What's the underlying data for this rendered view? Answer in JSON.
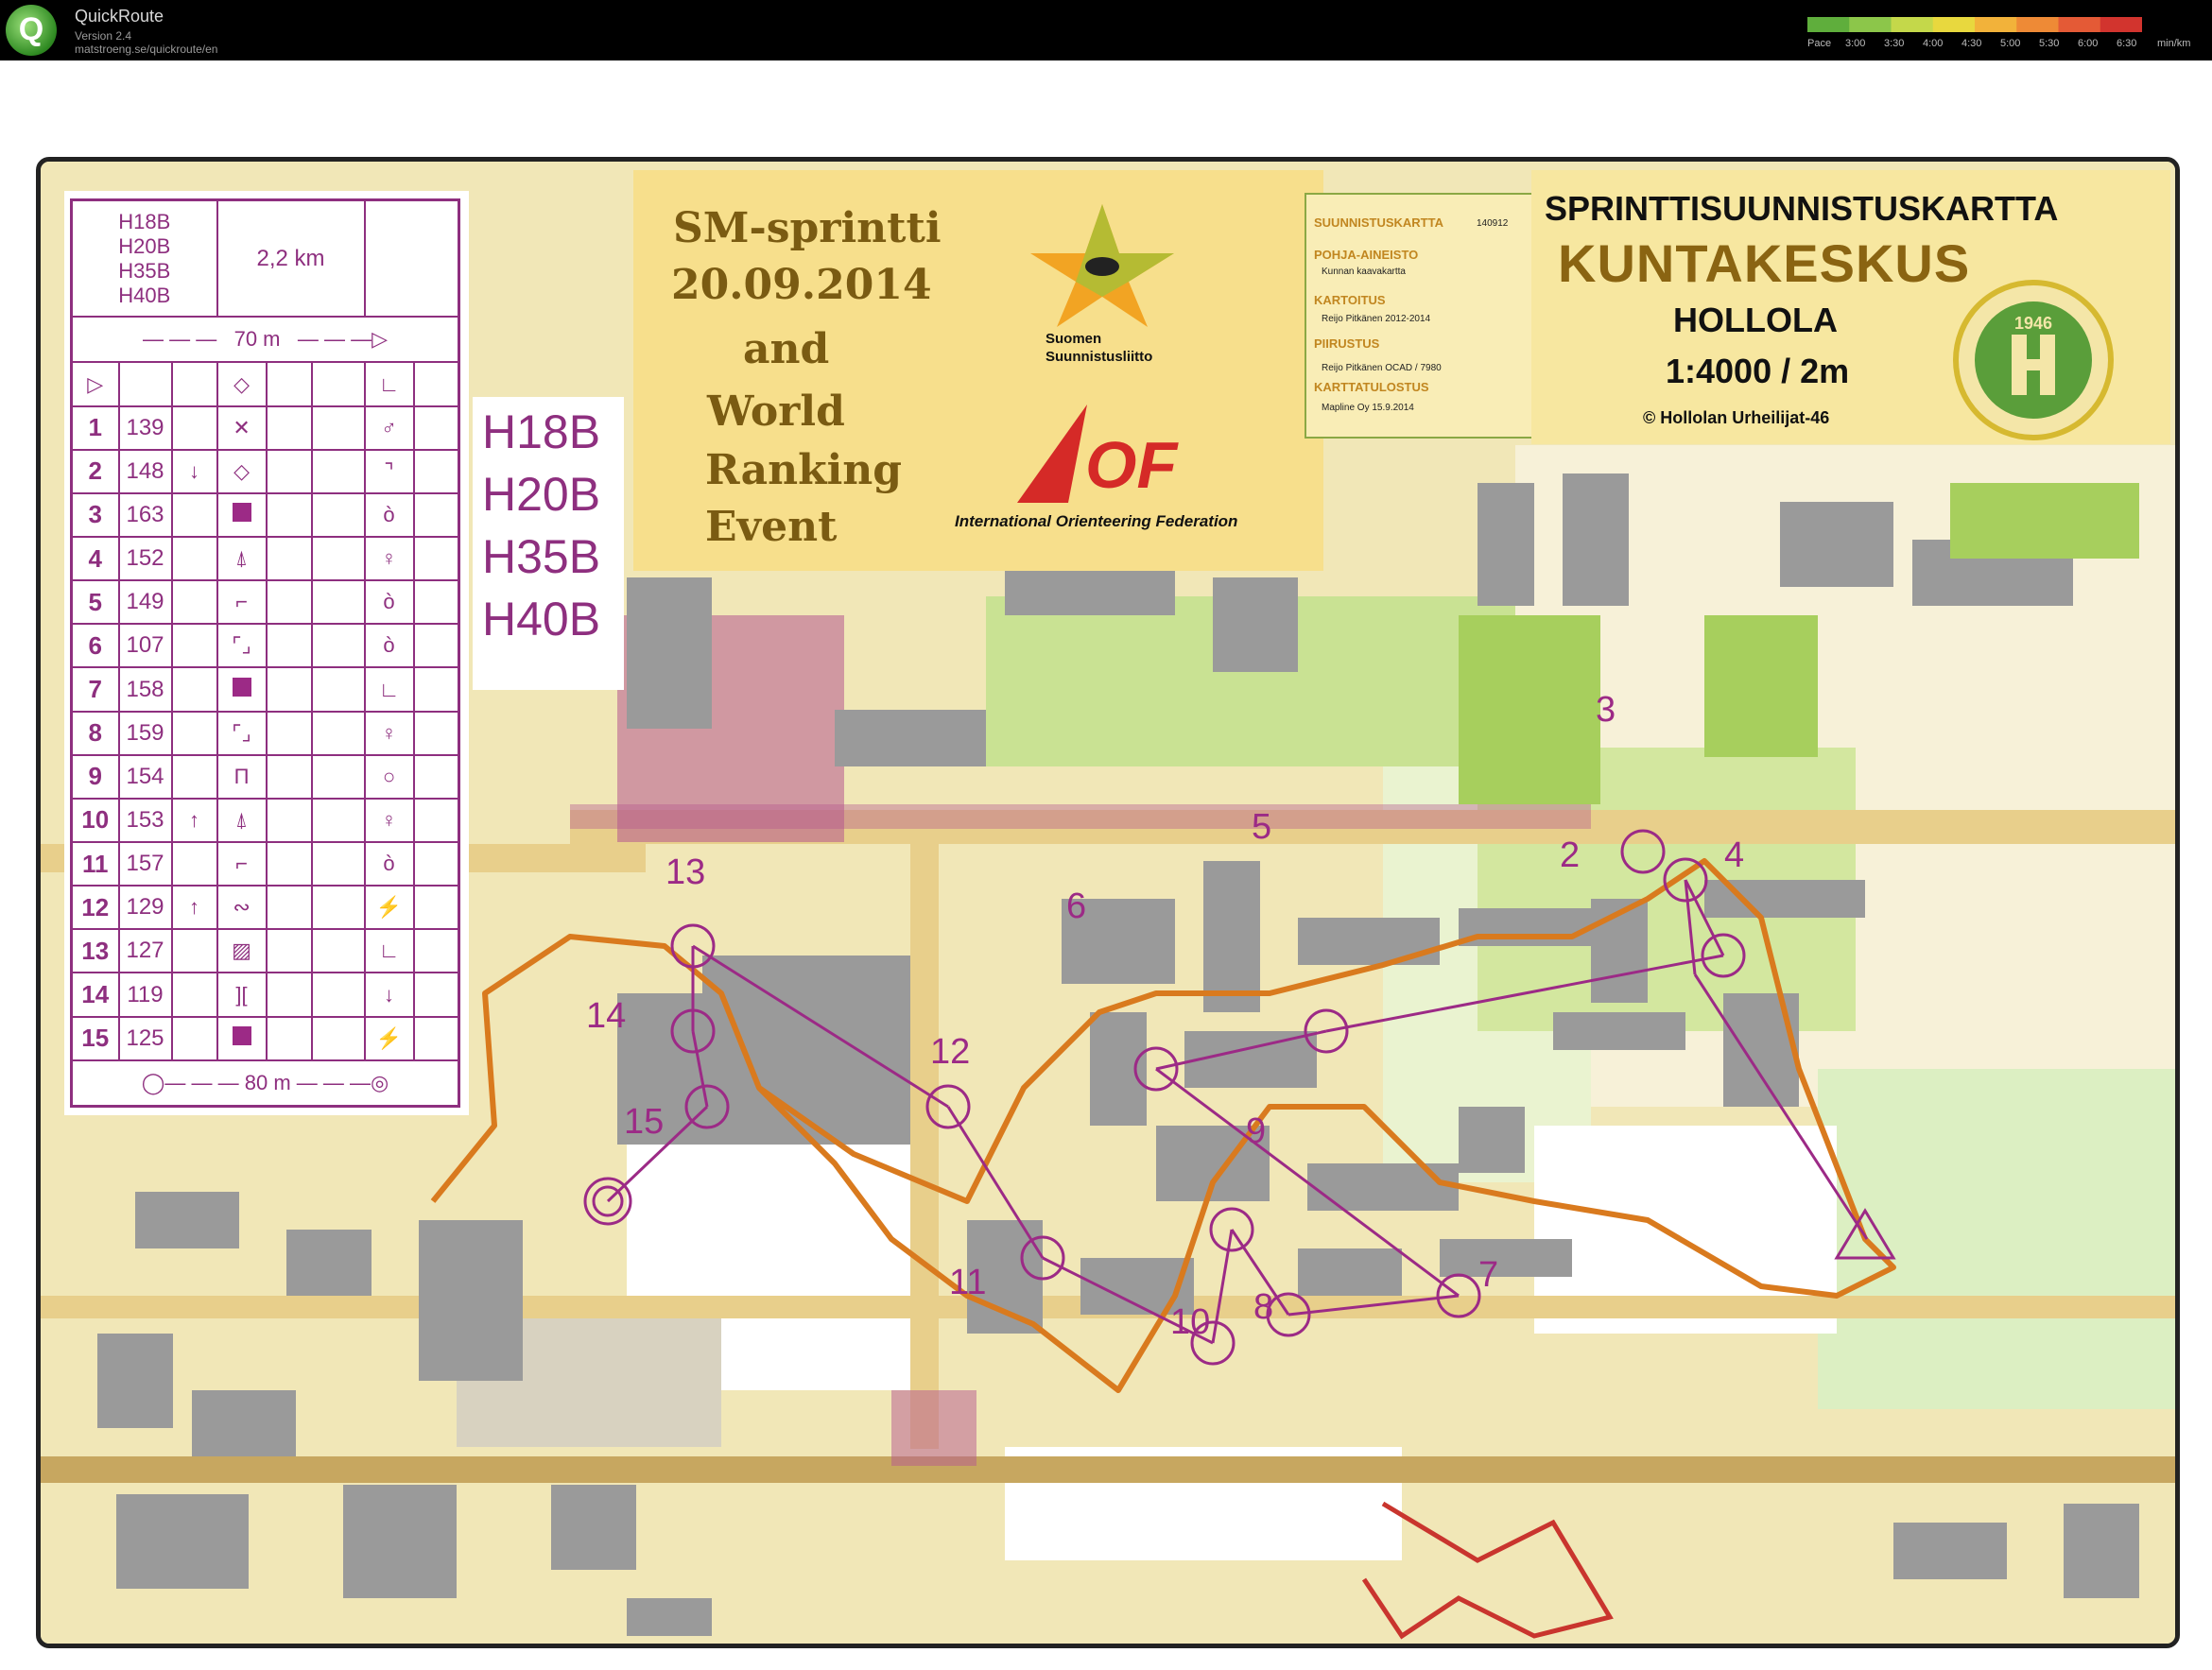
{
  "app": {
    "title": "QuickRoute",
    "version": "Version 2.4",
    "url": "matstroeng.se/quickroute/en",
    "logo_glyph": "Q"
  },
  "pace_legend": {
    "label": "Pace",
    "ticks": [
      "3:00",
      "3:30",
      "4:00",
      "4:30",
      "5:00",
      "5:30",
      "6:00",
      "6:30"
    ],
    "unit": "min/km",
    "colors": [
      "#5fae3c",
      "#8cc64a",
      "#c4d84a",
      "#e8d83e",
      "#f2b23a",
      "#ee8a36",
      "#e45a36",
      "#d2342e"
    ]
  },
  "description_sheet": {
    "classes": [
      "H18B",
      "H20B",
      "H35B",
      "H40B"
    ],
    "length": "2,2 km",
    "start_marking": "70 m",
    "finish_marking": "80 m",
    "controls": [
      {
        "num": "1",
        "code": "139",
        "direction": "",
        "feature": "x"
      },
      {
        "num": "2",
        "code": "148",
        "direction": "↓",
        "feature": "diamond"
      },
      {
        "num": "3",
        "code": "163",
        "direction": "",
        "feature": "box"
      },
      {
        "num": "4",
        "code": "152",
        "direction": "",
        "feature": "tree"
      },
      {
        "num": "5",
        "code": "149",
        "direction": "",
        "feature": "stairs"
      },
      {
        "num": "6",
        "code": "107",
        "direction": "",
        "feature": "corners"
      },
      {
        "num": "7",
        "code": "158",
        "direction": "",
        "feature": "box"
      },
      {
        "num": "8",
        "code": "159",
        "direction": "",
        "feature": "corners"
      },
      {
        "num": "9",
        "code": "154",
        "direction": "",
        "feature": "pillars"
      },
      {
        "num": "10",
        "code": "153",
        "direction": "↑",
        "feature": "tree"
      },
      {
        "num": "11",
        "code": "157",
        "direction": "",
        "feature": "stairs"
      },
      {
        "num": "12",
        "code": "129",
        "direction": "↑",
        "feature": "path"
      },
      {
        "num": "13",
        "code": "127",
        "direction": "",
        "feature": "hatch"
      },
      {
        "num": "14",
        "code": "119",
        "direction": "",
        "feature": "bracket"
      },
      {
        "num": "15",
        "code": "125",
        "direction": "",
        "feature": "box"
      }
    ]
  },
  "class_list": [
    "H18B",
    "H20B",
    "H35B",
    "H40B"
  ],
  "event": {
    "line1": "SM-sprintti",
    "line2": "20.09.2014",
    "line3": "and",
    "line4": "World",
    "line5": "Ranking",
    "line6": "Event",
    "federation_line1": "Suomen",
    "federation_line2": "Suunnistusliitto",
    "iof_logo_text": "OF",
    "iof_name": "International Orienteering Federation"
  },
  "credits": [
    {
      "heading": "SUUNNISTUSKARTTA",
      "value": "140912"
    },
    {
      "heading": "POHJA-AINEISTO",
      "value": "Kunnan kaavakartta"
    },
    {
      "heading": "KARTOITUS",
      "value": "Reijo Pitkänen 2012-2014"
    },
    {
      "heading": "PIIRUSTUS",
      "value": "Reijo Pitkänen OCAD / 7980"
    },
    {
      "heading": "KARTTATULOSTUS",
      "value": "Mapline Oy 15.9.2014"
    }
  ],
  "map_title": {
    "type": "SPRINTTISUUNNISTUSKARTTA",
    "name": "KUNTAKESKUS",
    "place": "HOLLOLA",
    "scale": "1:4000 / 2m",
    "copyright": "© Hollolan Urheilijat-46",
    "club_year": "1946"
  },
  "course": {
    "color": "#9c2a86",
    "route_color": "#d97a1e",
    "control_labels": [
      "2",
      "3",
      "4",
      "5",
      "6",
      "7",
      "8",
      "9",
      "10",
      "11",
      "12",
      "13",
      "14",
      "15"
    ]
  }
}
